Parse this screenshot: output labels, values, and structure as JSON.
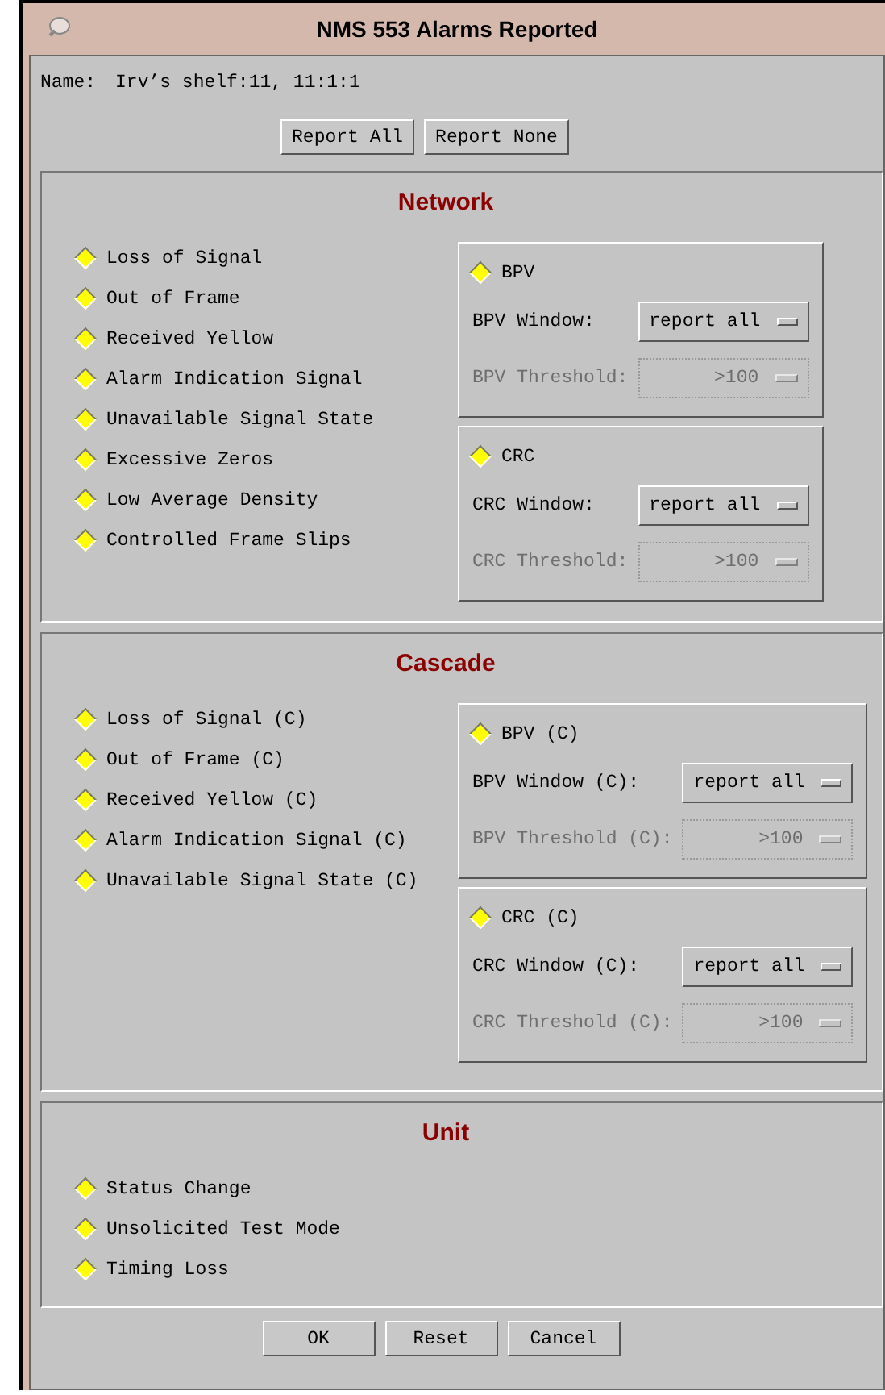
{
  "window": {
    "title": "NMS 553 Alarms Reported"
  },
  "name": {
    "label": "Name:",
    "value": "Irv’s shelf:11, 11:1:1"
  },
  "top_buttons": [
    "Report All",
    "Report None"
  ],
  "sections": [
    {
      "title": "Network",
      "alarms": [
        {
          "label": "Loss of Signal",
          "checked": true
        },
        {
          "label": "Out of Frame",
          "checked": true
        },
        {
          "label": "Received Yellow",
          "checked": true
        },
        {
          "label": "Alarm Indication Signal",
          "checked": true
        },
        {
          "label": "Unavailable Signal State",
          "checked": true
        },
        {
          "label": "Excessive Zeros",
          "checked": true
        },
        {
          "label": "Low Average Density",
          "checked": true
        },
        {
          "label": "Controlled Frame Slips",
          "checked": true
        }
      ],
      "groups": [
        {
          "toggle": {
            "label": "BPV",
            "checked": true
          },
          "fields": [
            {
              "label": "BPV Window:",
              "value": "report all",
              "disabled": false
            },
            {
              "label": "BPV Threshold:",
              "value": ">100",
              "disabled": true
            }
          ]
        },
        {
          "toggle": {
            "label": "CRC",
            "checked": true
          },
          "fields": [
            {
              "label": "CRC Window:",
              "value": "report all",
              "disabled": false
            },
            {
              "label": "CRC Threshold:",
              "value": ">100",
              "disabled": true
            }
          ]
        }
      ]
    },
    {
      "title": "Cascade",
      "alarms": [
        {
          "label": "Loss of Signal (C)",
          "checked": true
        },
        {
          "label": "Out of Frame (C)",
          "checked": true
        },
        {
          "label": "Received Yellow (C)",
          "checked": true
        },
        {
          "label": "Alarm Indication Signal (C)",
          "checked": true
        },
        {
          "label": "Unavailable Signal State (C)",
          "checked": true
        }
      ],
      "groups": [
        {
          "toggle": {
            "label": "BPV (C)",
            "checked": true
          },
          "fields": [
            {
              "label": "BPV Window (C):",
              "value": "report all",
              "disabled": false
            },
            {
              "label": "BPV Threshold (C):",
              "value": ">100",
              "disabled": true
            }
          ]
        },
        {
          "toggle": {
            "label": "CRC (C)",
            "checked": true
          },
          "fields": [
            {
              "label": "CRC Window (C):",
              "value": "report all",
              "disabled": false
            },
            {
              "label": "CRC Threshold (C):",
              "value": ">100",
              "disabled": true
            }
          ]
        }
      ]
    },
    {
      "title": "Unit",
      "alarms": [
        {
          "label": "Status Change",
          "checked": true
        },
        {
          "label": "Unsolicited Test Mode",
          "checked": true
        },
        {
          "label": "Timing Loss",
          "checked": true
        }
      ]
    }
  ],
  "buttons": [
    "OK",
    "Reset",
    "Cancel"
  ]
}
